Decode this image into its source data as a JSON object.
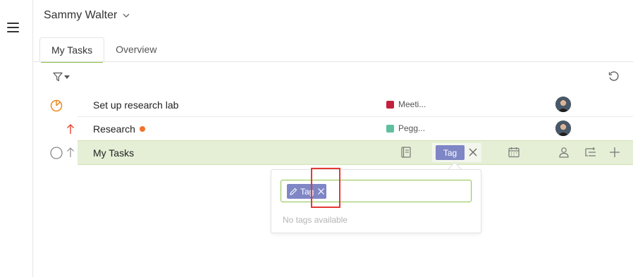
{
  "workspace": {
    "name": "Sammy Walter"
  },
  "tabs": [
    {
      "label": "My Tasks",
      "active": true
    },
    {
      "label": "Overview",
      "active": false
    }
  ],
  "tasks": [
    {
      "name": "Set up research lab",
      "status_icon": "timer-icon",
      "tag": {
        "label": "Meeti...",
        "color": "#c2203d"
      },
      "has_avatar": true
    },
    {
      "name": "Research",
      "status_icon": "arrow-up-icon",
      "dot_color": "#f0732e",
      "tag": {
        "label": "Pegg...",
        "color": "#5fbf9f"
      },
      "has_avatar": true
    }
  ],
  "active_row": {
    "name": "My Tasks",
    "tag_label": "Tag"
  },
  "tag_popup": {
    "chip_label": "Tag",
    "empty_text": "No tags available"
  },
  "colors": {
    "accent": "#8bc34a",
    "tag": "#7e86c5",
    "active_row_bg": "#e5efd6",
    "highlight": "#e53935"
  }
}
